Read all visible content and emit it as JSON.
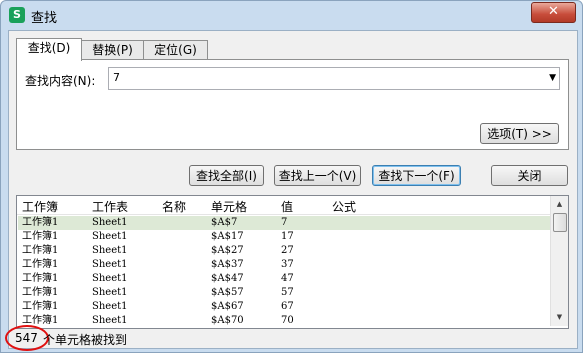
{
  "window": {
    "title": "查找",
    "app_icon": "S",
    "close_label": "✕"
  },
  "tabs": [
    {
      "label": "查找(D)",
      "active": true
    },
    {
      "label": "替换(P)",
      "active": false
    },
    {
      "label": "定位(G)",
      "active": false
    }
  ],
  "find": {
    "label": "查找内容(N):",
    "value": "7",
    "dropdown_icon": "chevron-down-icon"
  },
  "buttons": {
    "options": "选项(T) >>",
    "find_all": "查找全部(I)",
    "find_prev": "查找上一个(V)",
    "find_next": "查找下一个(F)",
    "close": "关闭"
  },
  "results": {
    "columns": [
      "工作簿",
      "工作表",
      "名称",
      "单元格",
      "值",
      "公式"
    ],
    "rows": [
      [
        "工作簿1",
        "Sheet1",
        "",
        "$A$7",
        "7",
        ""
      ],
      [
        "工作簿1",
        "Sheet1",
        "",
        "$A$17",
        "17",
        ""
      ],
      [
        "工作簿1",
        "Sheet1",
        "",
        "$A$27",
        "27",
        ""
      ],
      [
        "工作簿1",
        "Sheet1",
        "",
        "$A$37",
        "37",
        ""
      ],
      [
        "工作簿1",
        "Sheet1",
        "",
        "$A$47",
        "47",
        ""
      ],
      [
        "工作簿1",
        "Sheet1",
        "",
        "$A$57",
        "57",
        ""
      ],
      [
        "工作簿1",
        "Sheet1",
        "",
        "$A$67",
        "67",
        ""
      ],
      [
        "工作簿1",
        "Sheet1",
        "",
        "$A$70",
        "70",
        ""
      ]
    ],
    "selected_row": 0
  },
  "status": {
    "count": "547",
    "text": "个单元格被找到"
  },
  "colors": {
    "selection": "#dde9d6",
    "highlight_circle": "#e01010",
    "title_bg": "#c9dcef"
  }
}
